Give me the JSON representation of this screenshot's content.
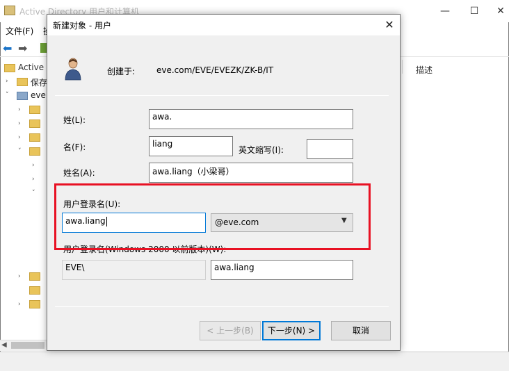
{
  "background_window": {
    "title": "Active Directory 用户和计算机",
    "menu": {
      "file": "文件(F)",
      "action": "操"
    },
    "tree_root": "Active D",
    "tree_items": [
      "保存",
      "eve."
    ],
    "description_column": "描述",
    "controls": {
      "minimize": "—",
      "maximize": "☐",
      "close": "✕"
    }
  },
  "dialog": {
    "title": "新建对象 - 用户",
    "close": "✕",
    "created_in_label": "创建于:",
    "created_in_path": "eve.com/EVE/EVEZK/ZK-B/IT",
    "last_name": {
      "label": "姓(L):",
      "value": "awa."
    },
    "first_name": {
      "label": "名(F):",
      "value": "liang"
    },
    "initials": {
      "label": "英文缩写(I):",
      "value": ""
    },
    "full_name": {
      "label": "姓名(A):",
      "value": "awa.liang（小梁哥）"
    },
    "logon_name": {
      "label": "用户登录名(U):",
      "value": "awa.liang"
    },
    "upn_suffix": "@eve.com",
    "pre2000": {
      "label": "用户登录名(Windows 2000 以前版本)(W):",
      "domain": "EVE\\",
      "value": "awa.liang"
    },
    "buttons": {
      "back": "< 上一步(B)",
      "next": "下一步(N) >",
      "cancel": "取消"
    }
  },
  "colors": {
    "highlight_box": "#e81123",
    "focus": "#0078d7"
  }
}
